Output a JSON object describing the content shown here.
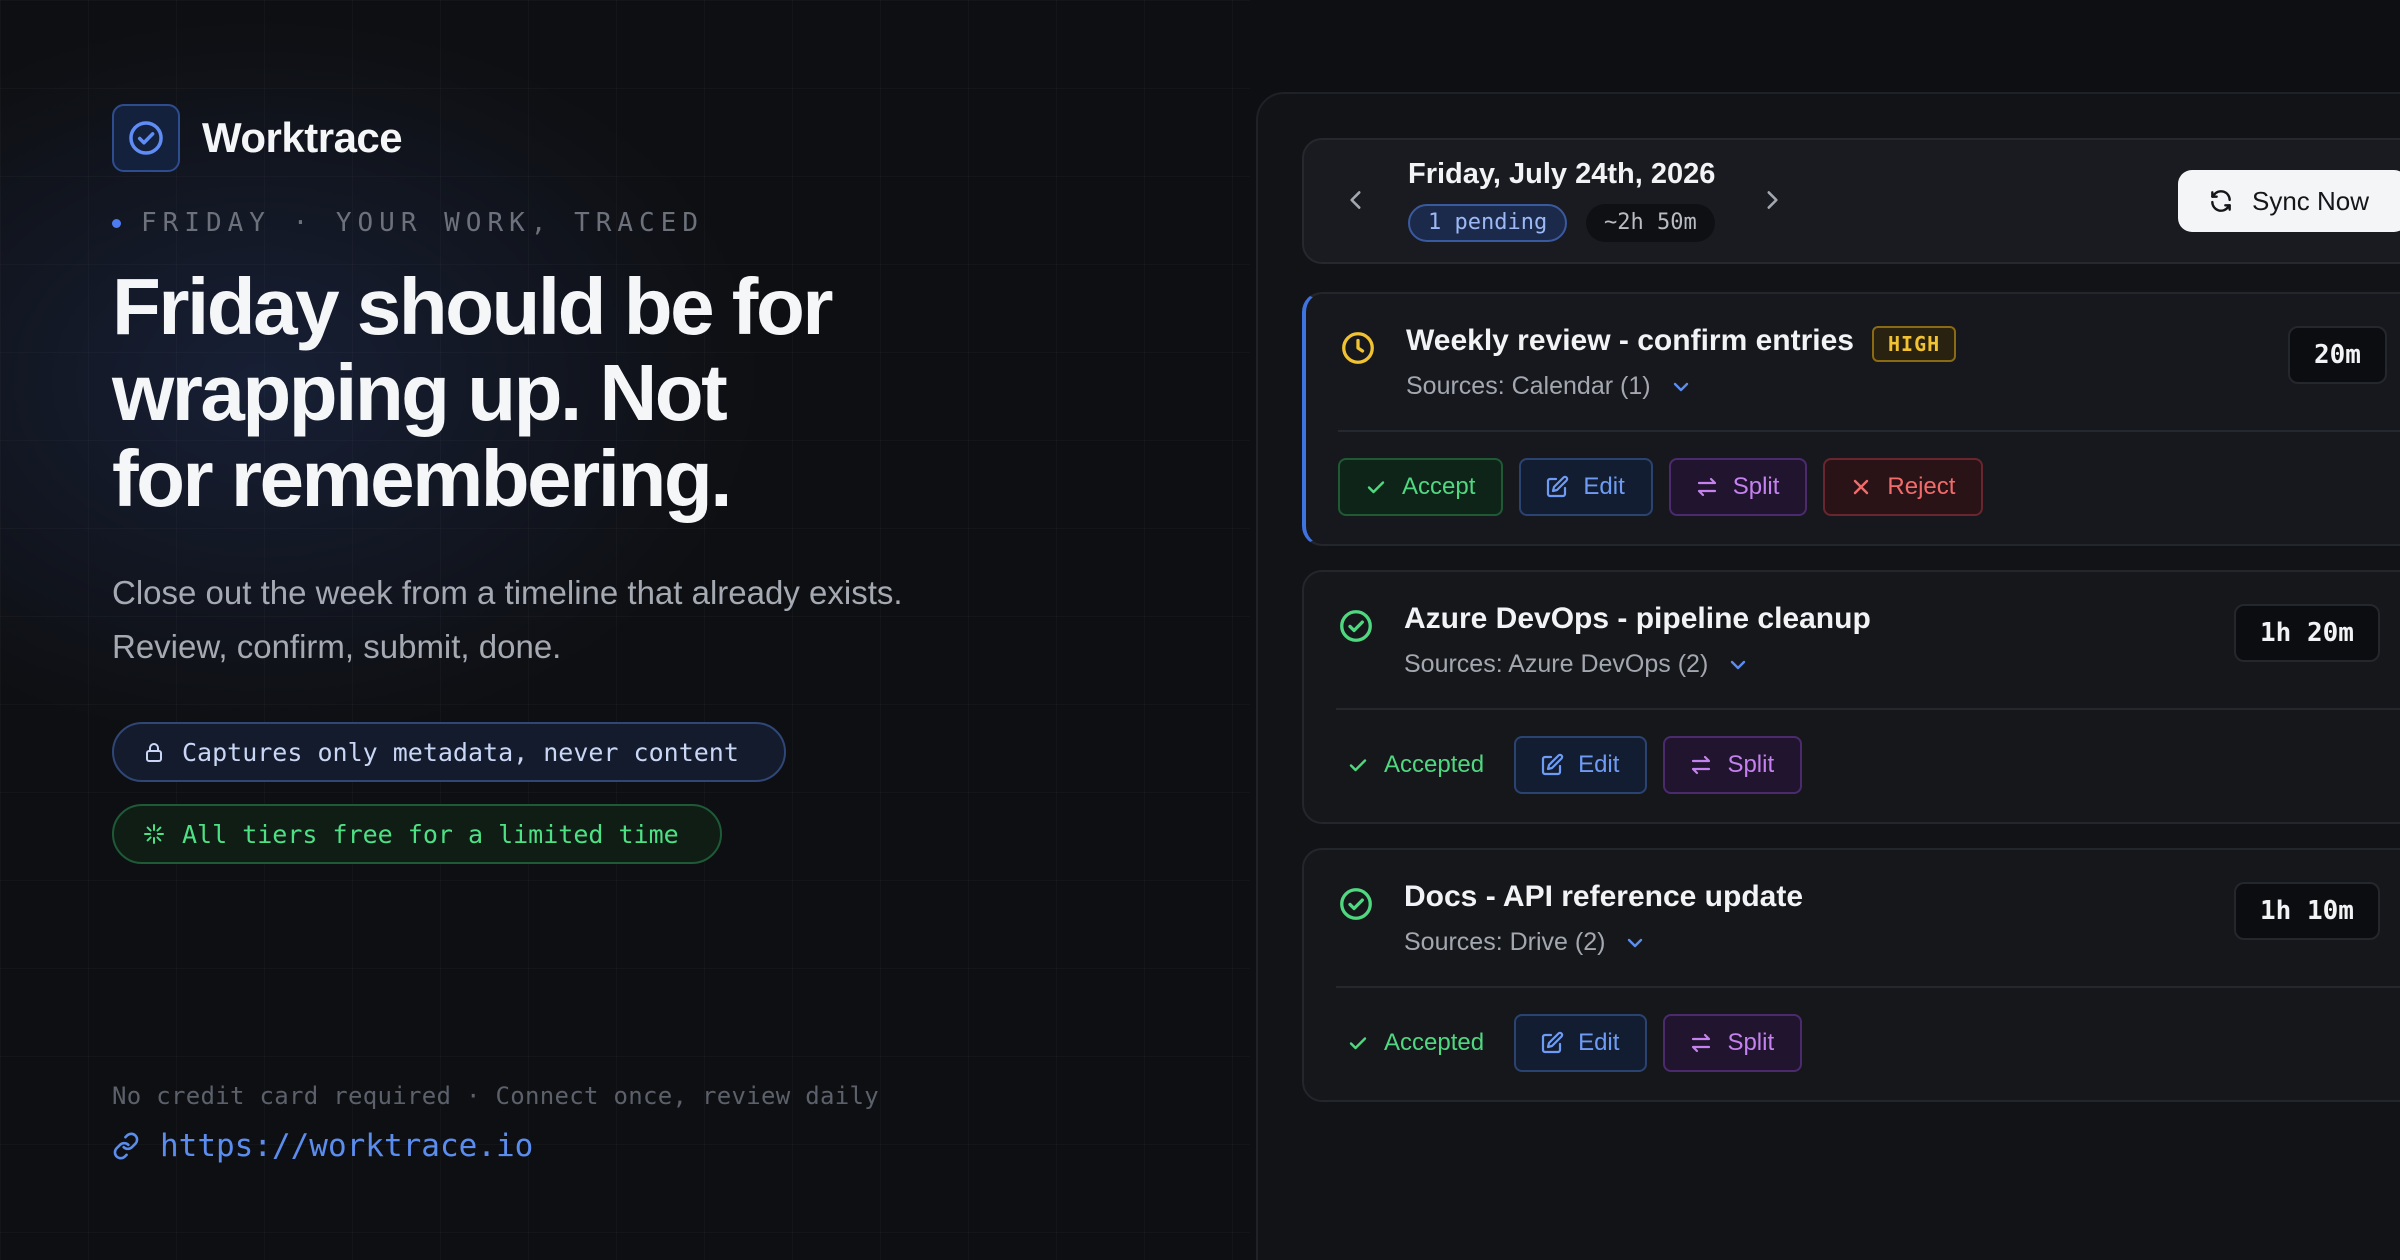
{
  "brand": {
    "name": "Worktrace"
  },
  "hero": {
    "eyebrow": "FRIDAY · YOUR WORK, TRACED",
    "headline": [
      "Friday should be for",
      "wrapping up. Not",
      "for remembering."
    ],
    "subtitle": [
      "Close out the week from a timeline that already exists.",
      "Review, confirm, submit, done."
    ],
    "pills": [
      {
        "icon": "lock-icon",
        "text": "Captures only metadata, never content"
      },
      {
        "icon": "sparkle-icon",
        "text": "All tiers free for a limited time"
      }
    ]
  },
  "footer": {
    "note": "No credit card required · Connect once, review daily",
    "link": "https://worktrace.io"
  },
  "panel": {
    "date": "Friday, July 24th, 2026",
    "pending_badge": "1 pending",
    "total_duration": "~2h 50m",
    "sync_label": "Sync Now",
    "entries": [
      {
        "status": "pending",
        "title": "Weekly review - confirm entries",
        "priority": "HIGH",
        "sources": "Sources: Calendar (1)",
        "duration": "20m",
        "actions": {
          "accept": "Accept",
          "edit": "Edit",
          "split": "Split",
          "reject": "Reject"
        }
      },
      {
        "status": "accepted",
        "title": "Azure DevOps - pipeline cleanup",
        "sources": "Sources: Azure DevOps (2)",
        "duration": "1h 20m",
        "state_label": "Accepted",
        "actions": {
          "edit": "Edit",
          "split": "Split"
        }
      },
      {
        "status": "accepted",
        "title": "Docs - API reference update",
        "sources": "Sources: Drive (2)",
        "duration": "1h 10m",
        "state_label": "Accepted",
        "actions": {
          "edit": "Edit",
          "split": "Split"
        }
      }
    ]
  },
  "colors": {
    "background": "#0e0f12",
    "accent_blue": "#4d7cf0",
    "accepted_green": "#4fd880",
    "pending_amber": "#f1c232",
    "split_purple": "#c681f0",
    "reject_red": "#f26b6b"
  }
}
